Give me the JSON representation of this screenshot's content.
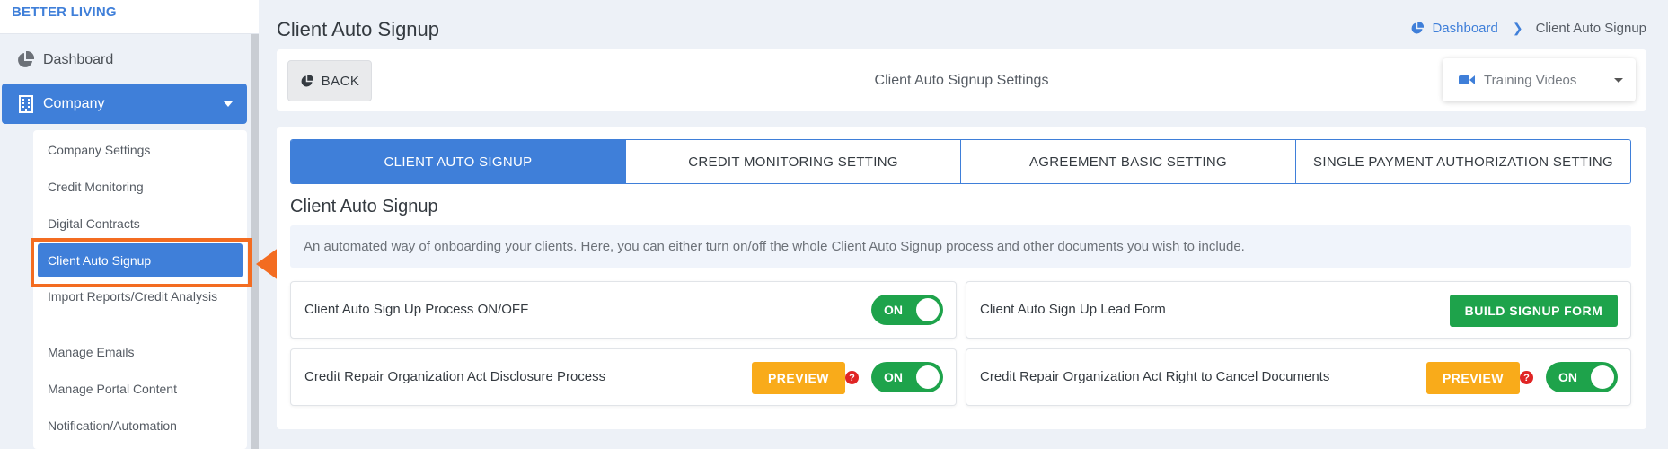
{
  "brand": {
    "name": "BETTER LIVING"
  },
  "sidebar": {
    "dashboard_label": "Dashboard",
    "company_label": "Company",
    "submenu": [
      {
        "label": "Company Settings"
      },
      {
        "label": "Credit Monitoring"
      },
      {
        "label": "Digital Contracts"
      },
      {
        "label": "Client Auto Signup",
        "active": true
      },
      {
        "label": "Import Reports/Credit Analysis"
      },
      {
        "label": "Manage Emails"
      },
      {
        "label": "Manage Portal Content"
      },
      {
        "label": "Notification/Automation"
      }
    ]
  },
  "header": {
    "title": "Client Auto Signup",
    "breadcrumb": {
      "home": "Dashboard",
      "current": "Client Auto Signup"
    }
  },
  "toolbar": {
    "back_label": "BACK",
    "title": "Client Auto Signup Settings",
    "videos_label": "Training Videos"
  },
  "tabs": [
    {
      "label": "CLIENT AUTO SIGNUP",
      "active": true
    },
    {
      "label": "CREDIT MONITORING SETTING"
    },
    {
      "label": "AGREEMENT BASIC SETTING"
    },
    {
      "label": "SINGLE PAYMENT AUTHORIZATION SETTING"
    }
  ],
  "section": {
    "title": "Client Auto Signup",
    "info": "An automated way of onboarding your clients. Here, you can either turn on/off the whole Client Auto Signup process and other documents you wish to include."
  },
  "settings": {
    "process_toggle": {
      "label": "Client Auto Sign Up Process ON/OFF",
      "state": "ON"
    },
    "lead_form": {
      "label": "Client Auto Sign Up Lead Form",
      "button": "BUILD SIGNUP FORM"
    },
    "disclosure": {
      "label": "Credit Repair Organization Act Disclosure Process",
      "preview": "PREVIEW",
      "help": "?",
      "state": "ON"
    },
    "cancel_docs": {
      "label": "Credit Repair Organization Act Right to Cancel Documents",
      "preview": "PREVIEW",
      "help": "?",
      "state": "ON"
    }
  },
  "colors": {
    "primary": "#3f7fd9",
    "success": "#1ea34b",
    "warning": "#f9ab1a",
    "highlight": "#f36c21",
    "danger": "#e02424"
  }
}
